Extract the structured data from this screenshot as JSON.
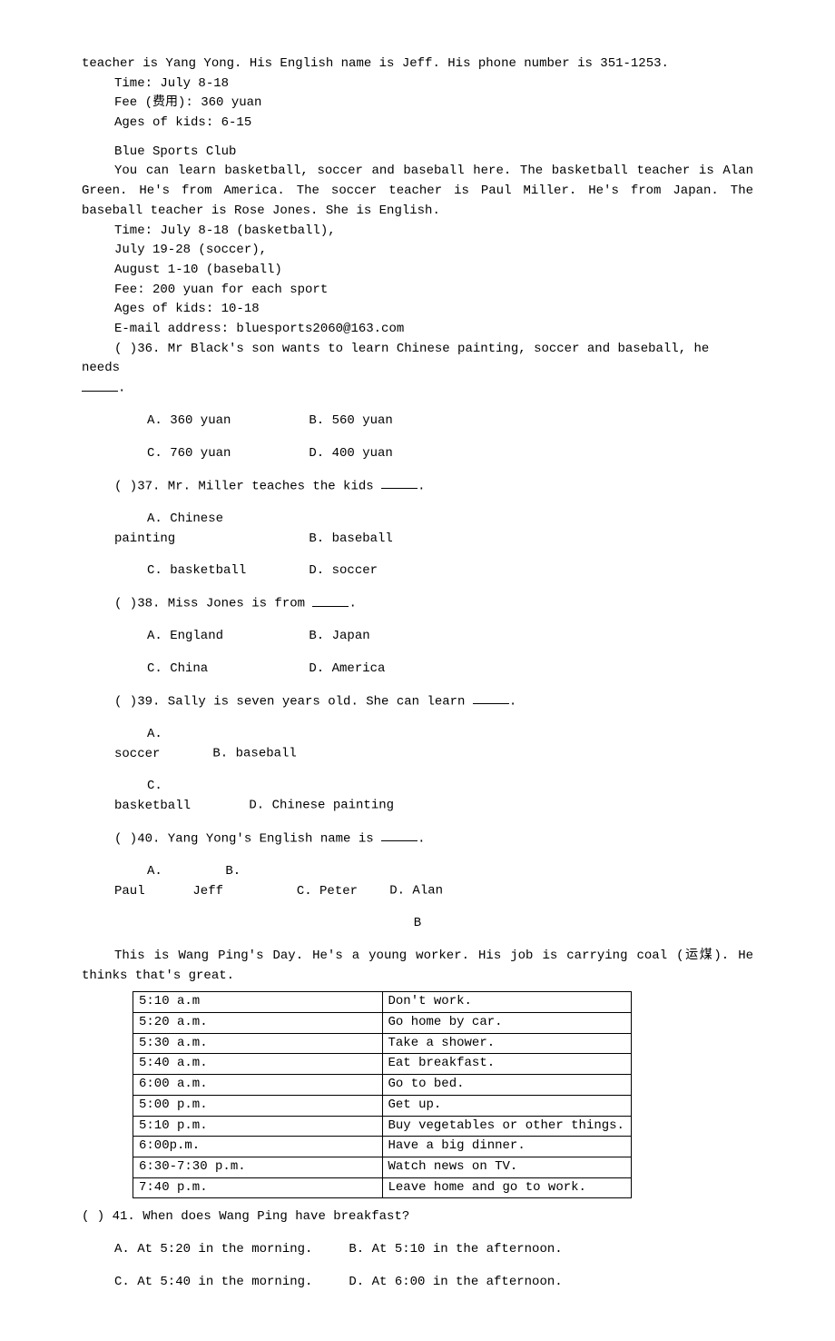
{
  "topText": "teacher is Yang Yong. His English name is Jeff. His phone number is 351-1253.",
  "artClub": {
    "time": "Time: July 8-18",
    "fee": "Fee (费用): 360 yuan",
    "ages": "Ages of kids: 6-15"
  },
  "sportsClub": {
    "title": "Blue Sports Club",
    "desc": "You can learn basketball, soccer and baseball here. The basketball teacher is Alan Green. He's from America. The soccer teacher is Paul Miller. He's from Japan. The baseball teacher is Rose Jones. She is English.",
    "time1": "Time: July 8-18 (basketball),",
    "time2": "July 19-28 (soccer),",
    "time3": "August 1-10 (baseball)",
    "fee": "Fee: 200 yuan for each sport",
    "ages": "Ages of kids: 10-18",
    "email": "E-mail address: bluesports2060@163.com"
  },
  "q36": {
    "stem_pre": "(  )36. Mr Black's son wants to learn Chinese painting, soccer and baseball, he needs ",
    "stem_post": ".",
    "a": "A. 360 yuan",
    "b": "B. 560 yuan",
    "c": "C. 760 yuan",
    "d": "D. 400 yuan"
  },
  "q37": {
    "stem_pre": "(  )37. Mr. Miller teaches the kids ",
    "stem_post": ".",
    "a": "A. Chinese painting",
    "b": "B. baseball",
    "c": "C. basketball",
    "d": "D. soccer"
  },
  "q38": {
    "stem_pre": "(  )38. Miss Jones is from ",
    "stem_post": ".",
    "a": "A. England",
    "b": "B. Japan",
    "c": "C. China",
    "d": "D. America"
  },
  "q39": {
    "stem_pre": "(  )39. Sally is seven years old. She can learn ",
    "stem_post": ".",
    "a": "A. soccer",
    "b": "B. baseball",
    "c": "C. basketball",
    "d": "D. Chinese painting"
  },
  "q40": {
    "stem_pre": "(  )40. Yang Yong's English name is ",
    "stem_post": ".",
    "a": "A. Paul",
    "b": "B. Jeff",
    "c": "C. Peter",
    "d": "D. Alan"
  },
  "sectionB": "B",
  "passageB": "This is Wang Ping's Day. He's a young worker. His job is carrying coal (运煤). He thinks that's great.",
  "schedule": [
    {
      "t": "5:10 a.m",
      "e": "Don't work."
    },
    {
      "t": "5:20 a.m.",
      "e": "Go home by car."
    },
    {
      "t": "5:30 a.m.",
      "e": "Take a shower."
    },
    {
      "t": "5:40 a.m.",
      "e": "Eat breakfast."
    },
    {
      "t": "6:00 a.m.",
      "e": "Go to bed."
    },
    {
      "t": "5:00 p.m.",
      "e": "Get up."
    },
    {
      "t": "5:10 p.m.",
      "e": "Buy vegetables or other things."
    },
    {
      "t": "6:00p.m.",
      "e": "Have a big dinner."
    },
    {
      "t": "6:30-7:30 p.m.",
      "e": "Watch news on TV."
    },
    {
      "t": "7:40 p.m.",
      "e": "Leave home and go to work."
    }
  ],
  "q41": {
    "stem": "(  ) 41. When does Wang Ping have breakfast?",
    "a": "A. At 5:20 in the morning.",
    "b": "B. At 5:10 in the afternoon.",
    "c": "C. At 5:40 in the morning.",
    "d": "D. At 6:00 in the afternoon."
  }
}
